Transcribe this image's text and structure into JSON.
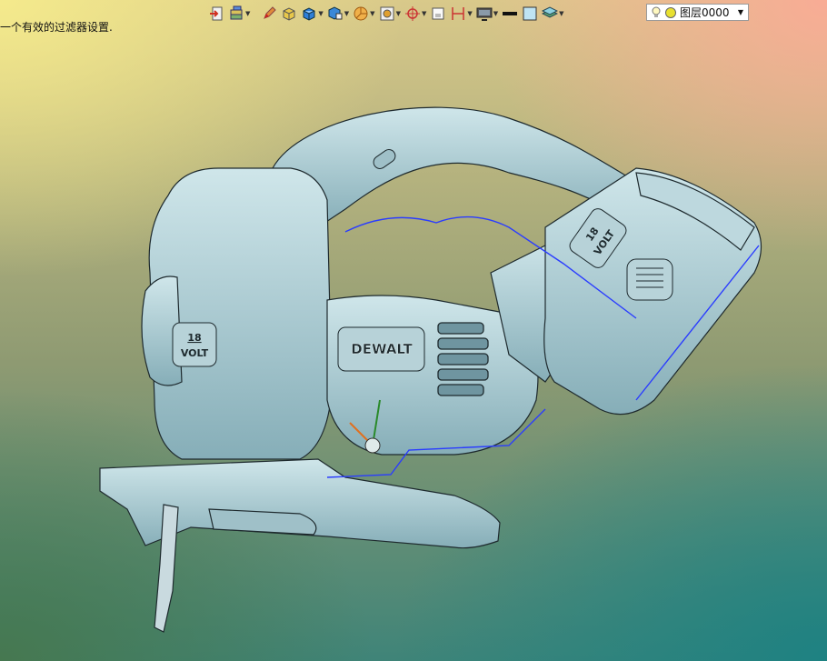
{
  "status_message": "一个有效的过滤器设置.",
  "toolbar": {
    "items": [
      {
        "icon": "exit-icon",
        "dropdown": false
      },
      {
        "icon": "layer-stack-icon",
        "dropdown": true
      },
      {
        "icon": "pencil-icon",
        "dropdown": false
      },
      {
        "icon": "box-shaded-icon",
        "dropdown": false
      },
      {
        "icon": "cube-blue-icon",
        "dropdown": true
      },
      {
        "icon": "cube-view-icon",
        "dropdown": true
      },
      {
        "icon": "pie-shade-icon",
        "dropdown": true
      },
      {
        "icon": "fit-view-icon",
        "dropdown": true
      },
      {
        "icon": "crosshair-icon",
        "dropdown": true
      },
      {
        "icon": "frame-icon",
        "dropdown": false
      },
      {
        "icon": "dimension-icon",
        "dropdown": true
      },
      {
        "icon": "monitor-icon",
        "dropdown": true
      },
      {
        "icon": "line-color-icon",
        "dropdown": false
      },
      {
        "icon": "fill-color-icon",
        "dropdown": false
      },
      {
        "icon": "layers-icon",
        "dropdown": true
      }
    ],
    "layer": {
      "value": "图层0000",
      "icons": [
        "lightbulb-icon",
        "layer-dot-icon"
      ]
    }
  },
  "model": {
    "brand": "DEWALT",
    "badge_volt_number": "18",
    "badge_volt_label": "VOLT",
    "colors": {
      "body": "#a9c9d0",
      "edge": "#1e2a2e",
      "highlight": "#2a3cff"
    }
  }
}
